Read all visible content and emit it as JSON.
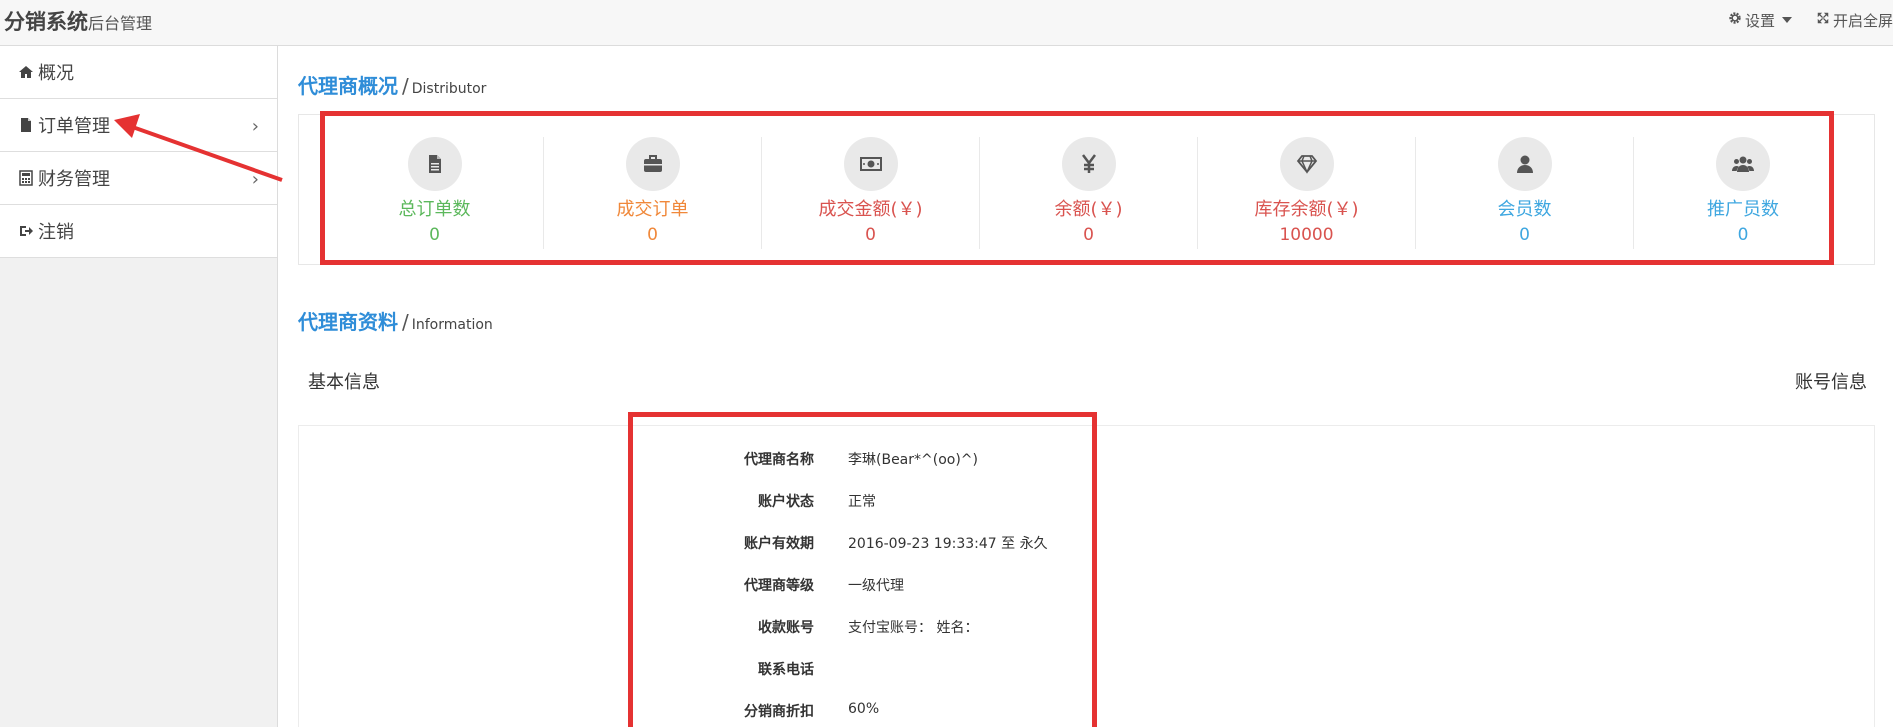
{
  "header": {
    "brand": "分销系统",
    "subtitle": "后台管理",
    "settings_label": "设置",
    "fullscreen_label": "开启全屏"
  },
  "sidebar": {
    "items": [
      {
        "label": "概况",
        "icon": "home-icon",
        "has_chevron": false
      },
      {
        "label": "订单管理",
        "icon": "file-icon",
        "has_chevron": true
      },
      {
        "label": "财务管理",
        "icon": "calculator-icon",
        "has_chevron": true
      },
      {
        "label": "注销",
        "icon": "sign-out-icon",
        "has_chevron": false
      }
    ]
  },
  "overview": {
    "title": "代理商概况",
    "sep": "/",
    "subtitle_en": "Distributor",
    "stats": [
      {
        "label": "总订单数",
        "value": "0",
        "color": "#5cb85c",
        "icon": "file-icon"
      },
      {
        "label": "成交订单",
        "value": "0",
        "color": "#f0883a",
        "icon": "briefcase-icon"
      },
      {
        "label": "成交金额(￥)",
        "value": "0",
        "color": "#d9534f",
        "icon": "money-icon"
      },
      {
        "label": "余额(￥)",
        "value": "0",
        "color": "#d9534f",
        "icon": "yen-icon"
      },
      {
        "label": "库存余额(￥)",
        "value": "10000",
        "color": "#d9534f",
        "icon": "diamond-icon"
      },
      {
        "label": "会员数",
        "value": "0",
        "color": "#3fa7e0",
        "icon": "user-icon"
      },
      {
        "label": "推广员数",
        "value": "0",
        "color": "#3fa7e0",
        "icon": "users-icon"
      }
    ]
  },
  "information": {
    "title": "代理商资料",
    "sep": "/",
    "subtitle_en": "Information",
    "tab_basic": "基本信息",
    "tab_account": "账号信息",
    "rows": [
      {
        "key": "代理商名称",
        "value": "李琳(Bear*^(oo)^)"
      },
      {
        "key": "账户状态",
        "value": "正常"
      },
      {
        "key": "账户有效期",
        "value": "2016-09-23 19:33:47 至 永久"
      },
      {
        "key": "代理商等级",
        "value": "一级代理"
      },
      {
        "key": "收款账号",
        "value": "支付宝账号： 姓名："
      },
      {
        "key": "联系电话",
        "value": ""
      },
      {
        "key": "分销商折扣",
        "value": "60%"
      }
    ]
  },
  "colors": {
    "accent": "#2f8dd8",
    "annotation_red": "#e53232"
  }
}
